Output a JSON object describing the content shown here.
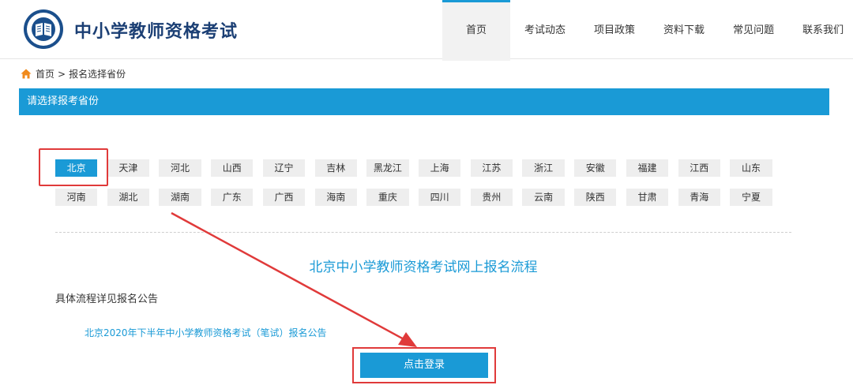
{
  "header": {
    "site_title": "中小学教师资格考试",
    "nav": [
      {
        "label": "首页",
        "active": true
      },
      {
        "label": "考试动态"
      },
      {
        "label": "项目政策"
      },
      {
        "label": "资料下载"
      },
      {
        "label": "常见问题"
      },
      {
        "label": "联系我们"
      }
    ]
  },
  "breadcrumb": {
    "home": "首页",
    "separator": ">",
    "current": "报名选择省份"
  },
  "title_bar": "请选择报考省份",
  "provinces": {
    "row1": [
      "北京",
      "天津",
      "河北",
      "山西",
      "辽宁",
      "吉林",
      "黑龙江",
      "上海",
      "江苏",
      "浙江",
      "安徽",
      "福建",
      "江西",
      "山东"
    ],
    "row2": [
      "河南",
      "湖北",
      "湖南",
      "广东",
      "广西",
      "海南",
      "重庆",
      "四川",
      "贵州",
      "云南",
      "陕西",
      "甘肃",
      "青海",
      "宁夏"
    ],
    "selected": "北京"
  },
  "flow_title": "北京中小学教师资格考试网上报名流程",
  "detail_text": "具体流程详见报名公告",
  "notice_link": "北京2020年下半年中小学教师资格考试（笔试）报名公告",
  "login_button": "点击登录",
  "colors": {
    "accent": "#1a9ad6",
    "brand": "#1b3f74",
    "annotation": "#e03a3a",
    "province_bg": "#eeeeee"
  },
  "icons": [
    "logo-icon",
    "home-icon"
  ]
}
